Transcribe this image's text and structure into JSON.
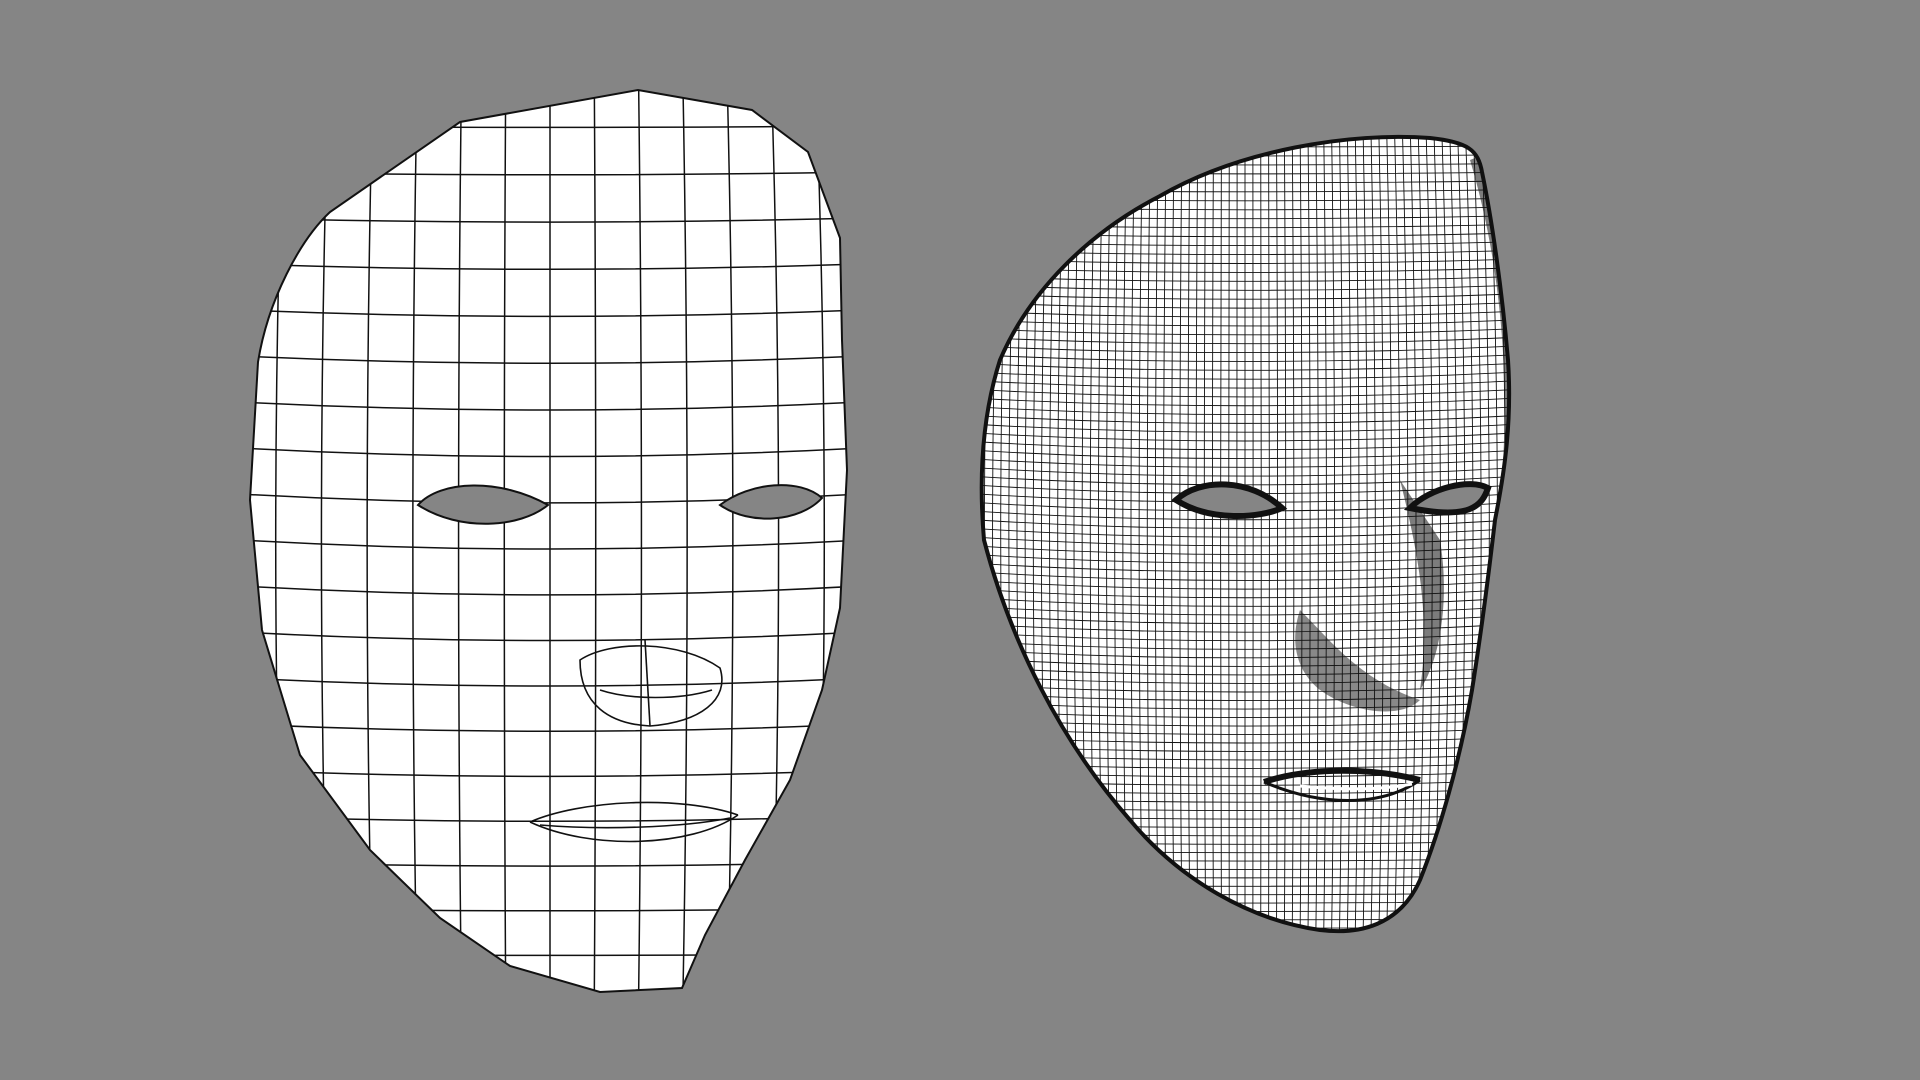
{
  "scene": {
    "background_color": "#858585",
    "mesh_fill_color": "#ffffff",
    "wire_color": "#111111",
    "models": [
      {
        "name": "low-poly-face-mask",
        "resolution": "low",
        "grid_rows": 20,
        "grid_cols": 14
      },
      {
        "name": "high-poly-face-mask",
        "resolution": "high",
        "grid_rows": 95,
        "grid_cols": 70
      }
    ]
  }
}
